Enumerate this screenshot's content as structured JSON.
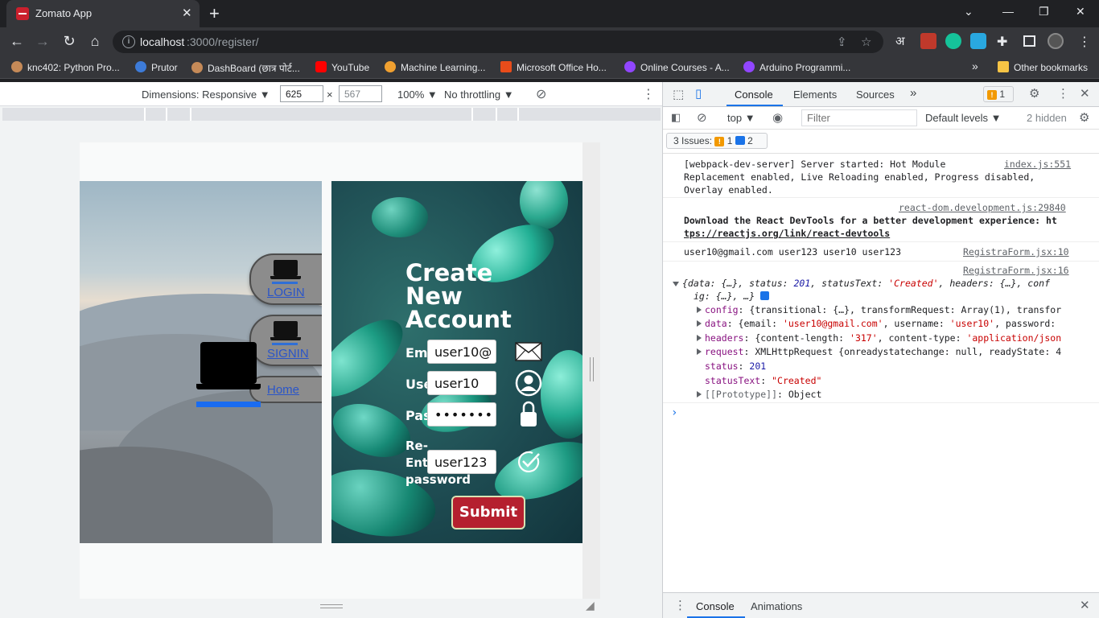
{
  "browser": {
    "tab_title": "Zomato App",
    "url_host": "localhost",
    "url_path": ":3000/register/",
    "bookmarks": [
      {
        "label": "knc402: Python Pro...",
        "color": "#c58a58"
      },
      {
        "label": "Prutor",
        "color": "#3d7bd8"
      },
      {
        "label": "DashBoard (छात्र पोर्ट...",
        "color": "#c58a58"
      },
      {
        "label": "YouTube",
        "color": "#ff0000"
      },
      {
        "label": "Machine Learning...",
        "color": "#f0a030"
      },
      {
        "label": "Microsoft Office Ho...",
        "color": "#e84c1a"
      },
      {
        "label": "Online Courses - A...",
        "color": "#9146ff"
      },
      {
        "label": "Arduino Programmi...",
        "color": "#9146ff"
      }
    ],
    "other_bookmarks": "Other bookmarks",
    "overflow": "»",
    "hindi_glyph": "अ"
  },
  "device_toolbar": {
    "dimensions": "Dimensions: Responsive",
    "width": "625",
    "height": "567",
    "times": "×",
    "zoom": "100%",
    "throttling": "No throttling"
  },
  "app": {
    "nav": {
      "login": "LOGIN",
      "signin": "SIGNIN",
      "home": "Home"
    },
    "form": {
      "title": "Create New Account",
      "email_label": "Email",
      "email_value": "user10@",
      "username_label": "Username",
      "username_value": "user10",
      "password_label": "Password",
      "password_value": "•••••••",
      "reenter_label_line1": "Re-",
      "reenter_label_line2": "Enter",
      "reenter_label_line3": "password",
      "reenter_value": "user123",
      "submit": "Submit"
    }
  },
  "devtools": {
    "tabs": [
      "Console",
      "Elements",
      "Sources"
    ],
    "more": "»",
    "issue_badge_count": "1",
    "context": "top",
    "filter_placeholder": "Filter",
    "levels": "Default levels",
    "hidden": "2 hidden",
    "issues_label": "3 Issues:",
    "issues_warn": "1",
    "issues_info": "2",
    "messages": {
      "m1_line1": "[webpack-dev-server] Server started: Hot Module",
      "m1_line2": "Replacement enabled, Live Reloading enabled, Progress disabled,",
      "m1_line3": "Overlay enabled.",
      "m1_src": "index.js:551",
      "m2_src": "react-dom.development.js:29840",
      "m2_line1": "Download the React DevTools for a better development experience: ht",
      "m2_line2": "tps://reactjs.org/link/react-devtools",
      "m3_line": "user10@gmail.com user123 user10 user123",
      "m3_src": "RegistraForm.jsx:10",
      "m4_src": "RegistraForm.jsx:16"
    },
    "object": {
      "summary_1a": "{data: {…}, status: ",
      "summary_status": "201",
      "summary_1b": ", statusText: ",
      "summary_status_text": "'Created'",
      "summary_1c": ", headers: {…}, conf",
      "summary_2": "ig: {…}, …}",
      "config_key": "config",
      "config_val": ": {transitional: {…}, transformRequest: Array(1), transfor",
      "data_key": "data",
      "data_a": ": {email: ",
      "data_email": "'user10@gmail.com'",
      "data_b": ", username: ",
      "data_user": "'user10'",
      "data_c": ", password:",
      "headers_key": "headers",
      "headers_a": ": {content-length: ",
      "headers_len": "'317'",
      "headers_b": ", content-type: ",
      "headers_type": "'application/json",
      "request_key": "request",
      "request_val": ": XMLHttpRequest {onreadystatechange: null, readyState: 4",
      "status_key": "status",
      "status_val": "201",
      "status_text_key": "statusText",
      "status_text_val": "\"Created\"",
      "proto_key": "[[Prototype]]",
      "proto_val": ": Object"
    },
    "drawer_tabs": [
      "Console",
      "Animations"
    ]
  }
}
